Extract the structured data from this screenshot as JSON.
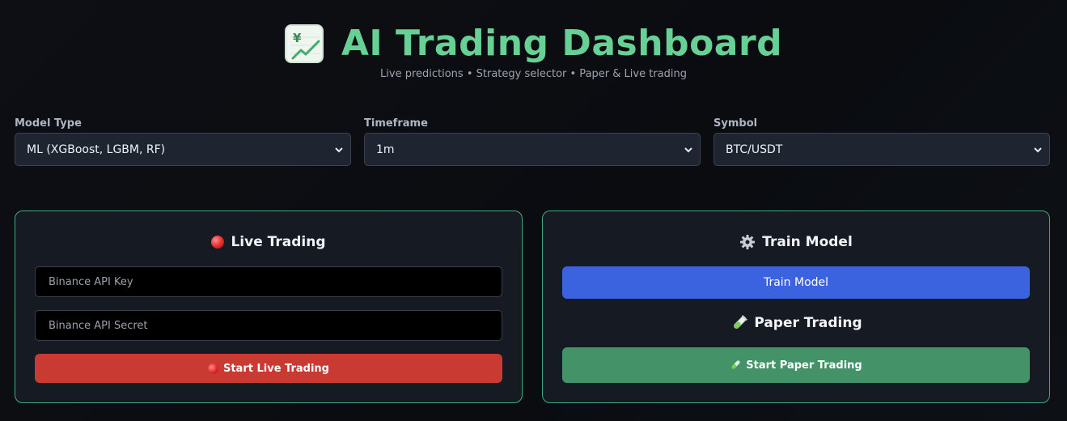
{
  "header": {
    "title": "AI Trading Dashboard",
    "subtitle": "Live predictions • Strategy selector • Paper & Live trading",
    "logo_icon": "chart-increasing-yen-icon"
  },
  "controls": {
    "model_type": {
      "label": "Model Type",
      "value": "ML (XGBoost, LGBM, RF)"
    },
    "timeframe": {
      "label": "Timeframe",
      "value": "1m"
    },
    "symbol": {
      "label": "Symbol",
      "value": "BTC/USDT"
    }
  },
  "live_panel": {
    "title": "Live Trading",
    "icon": "red-circle-icon",
    "api_key_placeholder": "Binance API Key",
    "api_secret_placeholder": "Binance API Secret",
    "start_button": "Start Live Trading",
    "button_color": "#c93a33"
  },
  "train_panel": {
    "title": "Train Model",
    "icon": "gear-icon",
    "train_button": "Train Model",
    "train_button_color": "#3b63e0",
    "paper_title": "Paper Trading",
    "paper_icon": "test-tube-icon",
    "paper_button": "Start Paper Trading",
    "paper_button_color": "#449268"
  },
  "colors": {
    "accent": "#67d094",
    "panel_border": "#3fae7b",
    "background": "#0d0f14"
  }
}
